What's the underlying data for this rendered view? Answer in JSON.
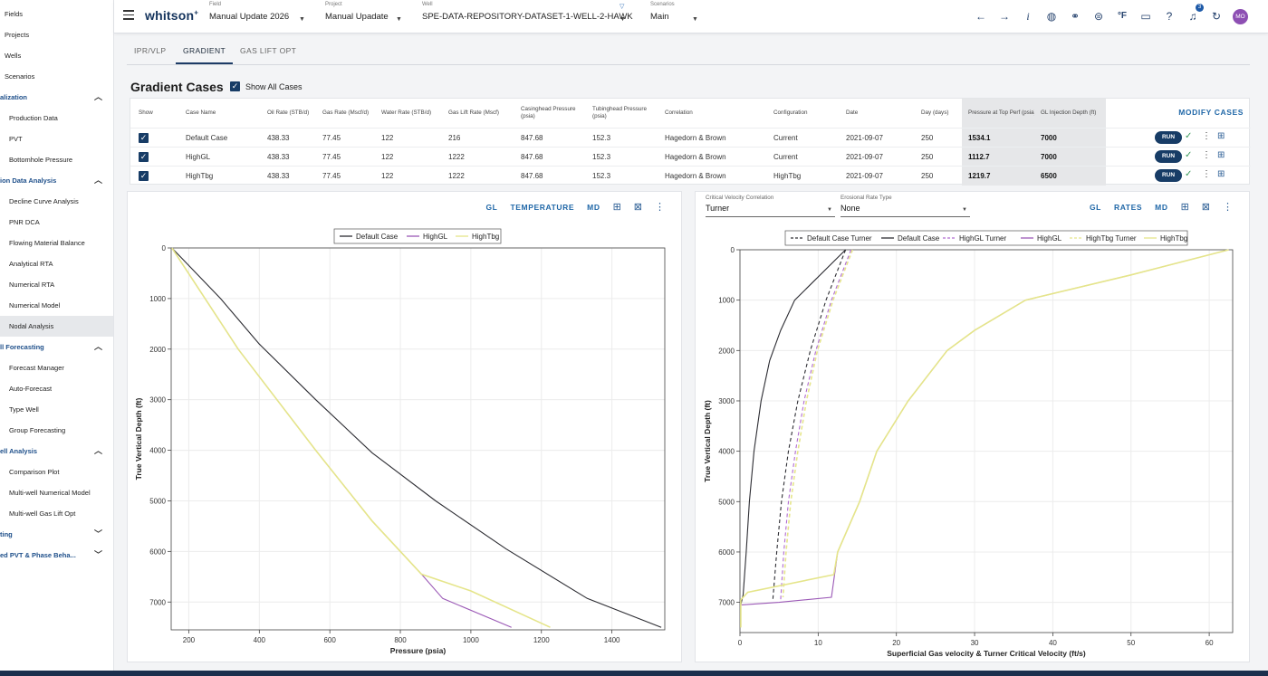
{
  "sidebar": {
    "items": [
      {
        "label": "Fields",
        "kind": "top"
      },
      {
        "label": "Projects",
        "kind": "top"
      },
      {
        "label": "Wells",
        "kind": "top"
      },
      {
        "label": "Scenarios",
        "kind": "top"
      },
      {
        "label": "alization",
        "kind": "sec",
        "chevron": "up"
      },
      {
        "label": "Production Data",
        "kind": "sub"
      },
      {
        "label": "PVT",
        "kind": "sub"
      },
      {
        "label": "Bottomhole Pressure",
        "kind": "sub"
      },
      {
        "label": "ion Data Analysis",
        "kind": "sec",
        "chevron": "up"
      },
      {
        "label": "Decline Curve Analysis",
        "kind": "sub"
      },
      {
        "label": "PNR DCA",
        "kind": "sub"
      },
      {
        "label": "Flowing Material Balance",
        "kind": "sub"
      },
      {
        "label": "Analytical RTA",
        "kind": "sub"
      },
      {
        "label": "Numerical RTA",
        "kind": "sub"
      },
      {
        "label": "Numerical Model",
        "kind": "sub"
      },
      {
        "label": "Nodal Analysis",
        "kind": "sub",
        "active": true
      },
      {
        "label": "ll Forecasting",
        "kind": "sec",
        "chevron": "up"
      },
      {
        "label": "Forecast Manager",
        "kind": "sub"
      },
      {
        "label": "Auto-Forecast",
        "kind": "sub"
      },
      {
        "label": "Type Well",
        "kind": "sub"
      },
      {
        "label": "Group Forecasting",
        "kind": "sub"
      },
      {
        "label": "ell Analysis",
        "kind": "sec",
        "chevron": "up"
      },
      {
        "label": "Comparison Plot",
        "kind": "sub"
      },
      {
        "label": "Multi-well Numerical Model",
        "kind": "sub"
      },
      {
        "label": "Multi-well Gas Lift Opt",
        "kind": "sub"
      },
      {
        "label": "ting",
        "kind": "sec",
        "chevron": "down"
      },
      {
        "label": "ed PVT & Phase Beha...",
        "kind": "sec",
        "chevron": "down"
      }
    ]
  },
  "topbar": {
    "logo": "whitson",
    "logo_sup": "+",
    "field_label": "Field",
    "field_value": "Manual Update 2026",
    "project_label": "Project",
    "project_value": "Manual Upadate",
    "well_label": "Well",
    "well_value": "SPE-DATA-REPOSITORY-DATASET-1-WELL-2-HAWK",
    "scenarios_label": "Scenarios",
    "scenarios_value": "Main",
    "notification_count": "3",
    "avatar_initials": "MO",
    "icons": [
      "arrow-left-icon",
      "arrow-right-icon",
      "info-icon",
      "globe-icon",
      "link-icon",
      "download-icon",
      "fahrenheit-icon",
      "feedback-icon",
      "help-icon",
      "bell-icon",
      "refresh-icon"
    ]
  },
  "tabs": [
    "IPR/VLP",
    "GRADIENT",
    "GAS LIFT OPT"
  ],
  "active_tab": "GRADIENT",
  "cases": {
    "title": "Gradient Cases",
    "show_all_label": "Show All Cases",
    "modify_label": "MODIFY CASES",
    "run_label": "RUN",
    "columns": [
      "Show",
      "Case Name",
      "Oil Rate (STB/d)",
      "Gas Rate (Mscf/d)",
      "Water Rate (STB/d)",
      "Gas Lift Rate (Mscf)",
      "Casinghead Pressure (psia)",
      "Tubinghead Pressure (psia)",
      "Correlation",
      "Configuration",
      "Date",
      "Day (days)",
      "Pressure at Top Perf (psia)",
      "GL Injection Depth (ft)"
    ],
    "rows": [
      {
        "name": "Default Case",
        "oil": "438.33",
        "gas": "77.45",
        "water": "122",
        "gl": "216",
        "chp": "847.68",
        "thp": "152.3",
        "corr": "Hagedorn & Brown",
        "config": "Current",
        "date": "2021-09-07",
        "day": "250",
        "ptp": "1534.1",
        "gldepth": "7000"
      },
      {
        "name": "HighGL",
        "oil": "438.33",
        "gas": "77.45",
        "water": "122",
        "gl": "1222",
        "chp": "847.68",
        "thp": "152.3",
        "corr": "Hagedorn & Brown",
        "config": "Current",
        "date": "2021-09-07",
        "day": "250",
        "ptp": "1112.7",
        "gldepth": "7000"
      },
      {
        "name": "HighTbg",
        "oil": "438.33",
        "gas": "77.45",
        "water": "122",
        "gl": "1222",
        "chp": "847.68",
        "thp": "152.3",
        "corr": "Hagedorn & Brown",
        "config": "HighTbg",
        "date": "2021-09-07",
        "day": "250",
        "ptp": "1219.7",
        "gldepth": "6500"
      }
    ]
  },
  "left_panel": {
    "tools": [
      "GL",
      "TEMPERATURE",
      "MD"
    ]
  },
  "right_panel": {
    "tools": [
      "GL",
      "RATES",
      "MD"
    ],
    "critical_label": "Critical Velocity Correlation",
    "critical_value": "Turner",
    "erosional_label": "Erosional Rate Type",
    "erosional_value": "None"
  },
  "chart_data": [
    {
      "type": "line",
      "xlabel": "Pressure (psia)",
      "ylabel": "True Vertical Depth (ft)",
      "xlim": [
        150,
        1550
      ],
      "ylim": [
        7550,
        0
      ],
      "xticks": [
        200,
        400,
        600,
        800,
        1000,
        1200,
        1400
      ],
      "yticks": [
        0,
        1000,
        2000,
        3000,
        4000,
        5000,
        6000,
        7000
      ],
      "grid": true,
      "legend": "top-center",
      "series": [
        {
          "name": "Default Case",
          "color": "#2d2d33",
          "dash": "",
          "points": [
            [
              152,
              0
            ],
            [
              290,
              1000
            ],
            [
              400,
              1900
            ],
            [
              560,
              3000
            ],
            [
              720,
              4050
            ],
            [
              900,
              5000
            ],
            [
              1100,
              5950
            ],
            [
              1330,
              6930
            ],
            [
              1540,
              7500
            ]
          ]
        },
        {
          "name": "HighGL",
          "color": "#9b59b6",
          "dash": "",
          "points": [
            [
              152,
              0
            ],
            [
              340,
              2000
            ],
            [
              560,
              4000
            ],
            [
              720,
              5400
            ],
            [
              860,
              6450
            ],
            [
              920,
              6930
            ],
            [
              1115,
              7500
            ]
          ]
        },
        {
          "name": "HighTbg",
          "color": "#e5e58a",
          "dash": "",
          "points": [
            [
              152,
              0
            ],
            [
              340,
              2000
            ],
            [
              560,
              4000
            ],
            [
              720,
              5400
            ],
            [
              860,
              6450
            ],
            [
              1000,
              6780
            ],
            [
              1225,
              7500
            ]
          ]
        }
      ]
    },
    {
      "type": "line",
      "xlabel": "Superficial Gas velocity & Turner Critical Velocity (ft/s)",
      "ylabel": "True Vertical Depth (ft)",
      "xlim": [
        0,
        63
      ],
      "ylim": [
        7600,
        0
      ],
      "xticks": [
        0,
        10,
        20,
        30,
        40,
        50,
        60
      ],
      "yticks": [
        0,
        1000,
        2000,
        3000,
        4000,
        5000,
        6000,
        7000
      ],
      "grid": true,
      "legend": "top-center",
      "series": [
        {
          "name": "Default Case Turner",
          "color": "#2d2d33",
          "dash": "4,3",
          "points": [
            [
              13.5,
              0
            ],
            [
              11,
              1000
            ],
            [
              9,
              2000
            ],
            [
              7.4,
              3000
            ],
            [
              6.2,
              4000
            ],
            [
              5.3,
              5000
            ],
            [
              4.7,
              6000
            ],
            [
              4.2,
              6950
            ]
          ]
        },
        {
          "name": "Default Case",
          "color": "#2d2d33",
          "dash": "",
          "points": [
            [
              13.5,
              0
            ],
            [
              7,
              1000
            ],
            [
              5.2,
              1600
            ],
            [
              3.8,
              2200
            ],
            [
              2.7,
              3000
            ],
            [
              1.8,
              4000
            ],
            [
              1.2,
              5000
            ],
            [
              0.8,
              6000
            ],
            [
              0.4,
              6850
            ],
            [
              0.1,
              7050
            ]
          ]
        },
        {
          "name": "HighGL Turner",
          "color": "#b06bd1",
          "dash": "4,3",
          "points": [
            [
              14.2,
              0
            ],
            [
              11.7,
              1000
            ],
            [
              9.7,
              2000
            ],
            [
              8.2,
              3000
            ],
            [
              7.1,
              4000
            ],
            [
              6.2,
              5000
            ],
            [
              5.6,
              6000
            ],
            [
              5.2,
              6950
            ]
          ]
        },
        {
          "name": "HighGL",
          "color": "#9b59b6",
          "dash": "",
          "points": [
            [
              0.2,
              7050
            ],
            [
              5,
              7000
            ],
            [
              11.7,
              6900
            ],
            [
              12.5,
              6000
            ],
            [
              15.3,
              5000
            ],
            [
              17.5,
              4000
            ],
            [
              21.5,
              3000
            ],
            [
              26.5,
              2000
            ],
            [
              30,
              1600
            ],
            [
              36.5,
              1000
            ],
            [
              50,
              500
            ],
            [
              62.5,
              0
            ]
          ]
        },
        {
          "name": "HighTbg Turner",
          "color": "#e5e58a",
          "dash": "4,3",
          "points": [
            [
              14.4,
              0
            ],
            [
              11.9,
              1000
            ],
            [
              9.9,
              2000
            ],
            [
              8.5,
              3000
            ],
            [
              7.4,
              4000
            ],
            [
              6.5,
              5000
            ],
            [
              5.9,
              6000
            ],
            [
              5.5,
              6900
            ]
          ]
        },
        {
          "name": "HighTbg",
          "color": "#e5e58a",
          "dash": "",
          "points": [
            [
              0.1,
              7500
            ],
            [
              0.1,
              6950
            ],
            [
              1,
              6800
            ],
            [
              12,
              6450
            ],
            [
              12.5,
              6000
            ],
            [
              15.3,
              5000
            ],
            [
              17.5,
              4000
            ],
            [
              21.5,
              3000
            ],
            [
              26.5,
              2000
            ],
            [
              30,
              1600
            ],
            [
              36.5,
              1000
            ],
            [
              50,
              500
            ],
            [
              62.5,
              0
            ]
          ]
        }
      ]
    }
  ]
}
